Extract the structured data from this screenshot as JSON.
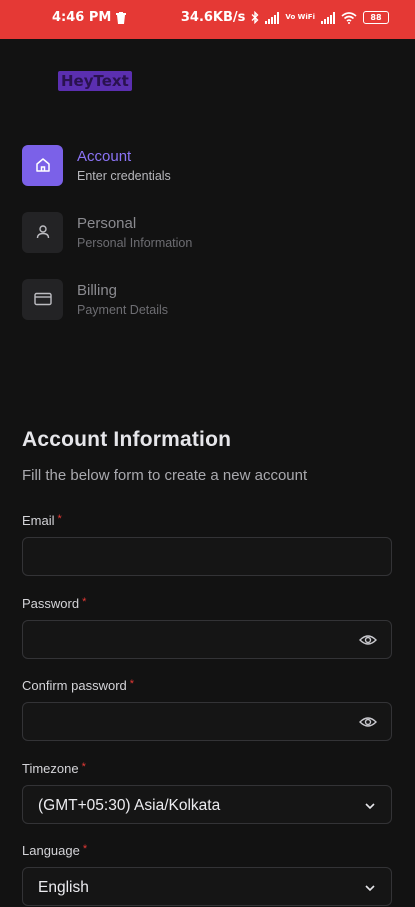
{
  "status_bar": {
    "time": "4:46 PM",
    "network_speed": "34.6KB/s",
    "vowifi": "Vo WiFi",
    "battery": "88"
  },
  "app": {
    "logo_text": "HeyText"
  },
  "steps": [
    {
      "title": "Account",
      "subtitle": "Enter credentials",
      "icon": "home-icon",
      "active": true
    },
    {
      "title": "Personal",
      "subtitle": "Personal Information",
      "icon": "user-icon",
      "active": false
    },
    {
      "title": "Billing",
      "subtitle": "Payment Details",
      "icon": "credit-card-icon",
      "active": false
    }
  ],
  "form": {
    "title": "Account Information",
    "subtitle": "Fill the below form to create a new account",
    "required_mark": "*",
    "email": {
      "label": "Email",
      "value": ""
    },
    "password": {
      "label": "Password",
      "value": ""
    },
    "confirm_password": {
      "label": "Confirm password",
      "value": ""
    },
    "timezone": {
      "label": "Timezone",
      "value": "(GMT+05:30) Asia/Kolkata"
    },
    "language": {
      "label": "Language",
      "value": "English"
    }
  },
  "colors": {
    "status_bar": "#e53935",
    "background": "#121212",
    "accent": "#7b61e8",
    "required": "#e53935"
  }
}
